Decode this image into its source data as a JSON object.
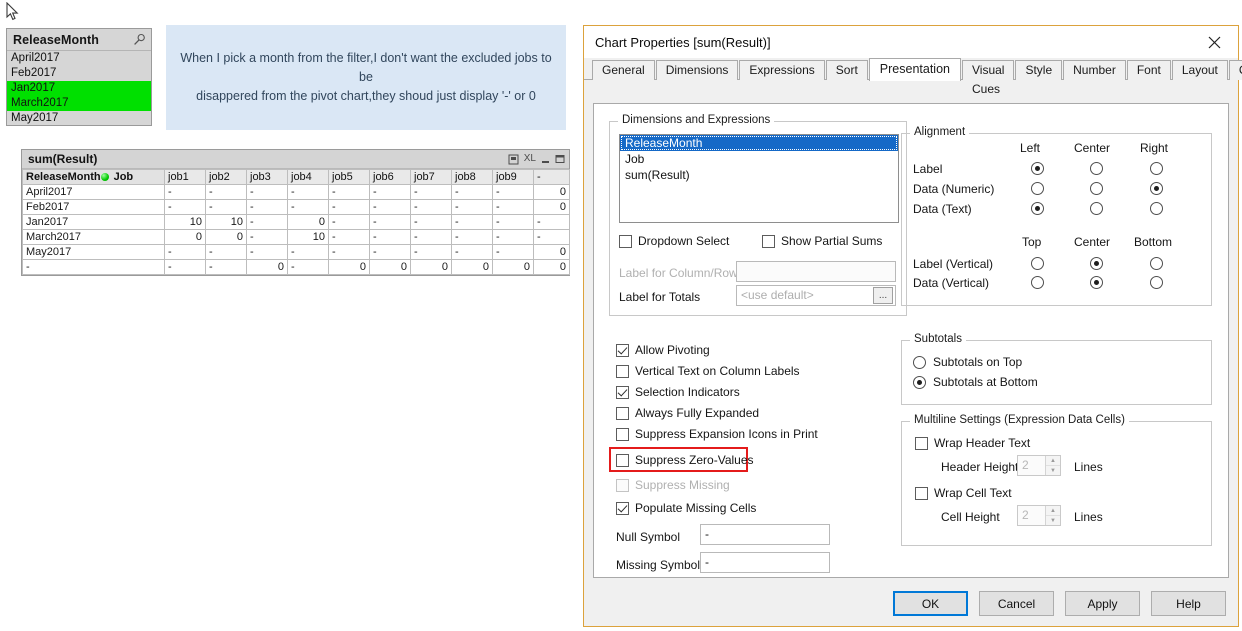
{
  "listbox": {
    "title": "ReleaseMonth",
    "search_icon": "search-icon",
    "items": [
      {
        "label": "April2017",
        "selected": false
      },
      {
        "label": "Feb2017",
        "selected": false
      },
      {
        "label": "Jan2017",
        "selected": true
      },
      {
        "label": "March2017",
        "selected": true
      },
      {
        "label": "May2017",
        "selected": false
      }
    ],
    "selected_color": "#00e000"
  },
  "callout": {
    "line1": "When I pick a month from the filter,I don't want the excluded jobs to be",
    "line2": "disappered from the pivot chart,they shoud just display '-' or 0",
    "background": "#dae7f5"
  },
  "pivot": {
    "caption": "sum(Result)",
    "caption_icons": [
      "print-icon",
      "export-xl-icon",
      "minimize-icon",
      "maximize-icon"
    ],
    "dimension_label": "ReleaseMonth",
    "second_label": "Job",
    "columns": [
      "job1",
      "job2",
      "job3",
      "job4",
      "job5",
      "job6",
      "job7",
      "job8",
      "job9",
      "-"
    ],
    "rows": [
      {
        "label": "April2017",
        "cells": [
          "-",
          "-",
          "-",
          "-",
          "-",
          "-",
          "-",
          "-",
          "-",
          "0"
        ]
      },
      {
        "label": "Feb2017",
        "cells": [
          "-",
          "-",
          "-",
          "-",
          "-",
          "-",
          "-",
          "-",
          "-",
          "0"
        ]
      },
      {
        "label": "Jan2017",
        "cells": [
          "10",
          "10",
          "-",
          "0",
          "-",
          "-",
          "-",
          "-",
          "-",
          "-"
        ]
      },
      {
        "label": "March2017",
        "cells": [
          "0",
          "0",
          "-",
          "10",
          "-",
          "-",
          "-",
          "-",
          "-",
          "-"
        ]
      },
      {
        "label": "May2017",
        "cells": [
          "-",
          "-",
          "-",
          "-",
          "-",
          "-",
          "-",
          "-",
          "-",
          "0"
        ]
      },
      {
        "label": "-",
        "cells": [
          "-",
          "-",
          "0",
          "-",
          "0",
          "0",
          "0",
          "0",
          "0",
          "0"
        ]
      }
    ]
  },
  "dialog": {
    "title": "Chart Properties [sum(Result)]",
    "close_icon": "close-icon",
    "border_color": "#dca23c",
    "tabs": [
      {
        "label": "General",
        "active": false
      },
      {
        "label": "Dimensions",
        "active": false
      },
      {
        "label": "Expressions",
        "active": false
      },
      {
        "label": "Sort",
        "active": false
      },
      {
        "label": "Presentation",
        "active": true
      },
      {
        "label": "Visual Cues",
        "active": false
      },
      {
        "label": "Style",
        "active": false
      },
      {
        "label": "Number",
        "active": false
      },
      {
        "label": "Font",
        "active": false
      },
      {
        "label": "Layout",
        "active": false
      },
      {
        "label": "Caption",
        "active": false
      }
    ],
    "dimensions_group": {
      "legend": "Dimensions and Expressions",
      "items": [
        {
          "label": "ReleaseMonth",
          "selected": true
        },
        {
          "label": "Job",
          "selected": false
        },
        {
          "label": "sum(Result)",
          "selected": false
        }
      ],
      "dropdown_select": {
        "label": "Dropdown Select",
        "checked": false
      },
      "show_partial_sums": {
        "label": "Show Partial Sums",
        "checked": false
      },
      "label_for_column_row": {
        "label": "Label for Column/Row",
        "value": "",
        "disabled": true
      },
      "label_for_totals": {
        "label": "Label for Totals",
        "placeholder": "<use default>",
        "value": "",
        "browse": "..."
      }
    },
    "alignment_group": {
      "legend": "Alignment",
      "h_headers": [
        "Left",
        "Center",
        "Right"
      ],
      "v_headers": [
        "Top",
        "Center",
        "Bottom"
      ],
      "h_rows": [
        {
          "label": "Label",
          "selected": 0
        },
        {
          "label": "Data (Numeric)",
          "selected": 2
        },
        {
          "label": "Data (Text)",
          "selected": 0
        }
      ],
      "v_rows": [
        {
          "label": "Label (Vertical)",
          "selected": 1
        },
        {
          "label": "Data (Vertical)",
          "selected": 1
        }
      ]
    },
    "options": [
      {
        "label": "Allow Pivoting",
        "checked": true,
        "disabled": false,
        "highlight": false
      },
      {
        "label": "Vertical Text on Column Labels",
        "checked": false,
        "disabled": false,
        "highlight": false
      },
      {
        "label": "Selection Indicators",
        "checked": true,
        "disabled": false,
        "highlight": false
      },
      {
        "label": "Always Fully Expanded",
        "checked": false,
        "disabled": false,
        "highlight": false
      },
      {
        "label": "Suppress Expansion Icons in Print",
        "checked": false,
        "disabled": false,
        "highlight": false
      },
      {
        "label": "Suppress Zero-Values",
        "checked": false,
        "disabled": false,
        "highlight": true
      },
      {
        "label": "Suppress Missing",
        "checked": false,
        "disabled": true,
        "highlight": false
      },
      {
        "label": "Populate Missing Cells",
        "checked": true,
        "disabled": false,
        "highlight": false
      }
    ],
    "highlight_color": "#e41b1b",
    "null_symbol": {
      "label": "Null Symbol",
      "value": "-"
    },
    "missing_symbol": {
      "label": "Missing Symbol",
      "value": "-"
    },
    "subtotals_group": {
      "legend": "Subtotals",
      "options": [
        {
          "label": "Subtotals on Top",
          "selected": false
        },
        {
          "label": "Subtotals at Bottom",
          "selected": true
        }
      ]
    },
    "multiline_group": {
      "legend": "Multiline Settings (Expression Data Cells)",
      "wrap_header_text": {
        "label": "Wrap Header Text",
        "checked": false
      },
      "header_height": {
        "label": "Header Height",
        "value": "2",
        "unit": "Lines"
      },
      "wrap_cell_text": {
        "label": "Wrap Cell Text",
        "checked": false
      },
      "cell_height": {
        "label": "Cell Height",
        "value": "2",
        "unit": "Lines"
      }
    },
    "buttons": [
      {
        "label": "OK",
        "primary": true
      },
      {
        "label": "Cancel",
        "primary": false
      },
      {
        "label": "Apply",
        "primary": false
      },
      {
        "label": "Help",
        "primary": false
      }
    ]
  }
}
